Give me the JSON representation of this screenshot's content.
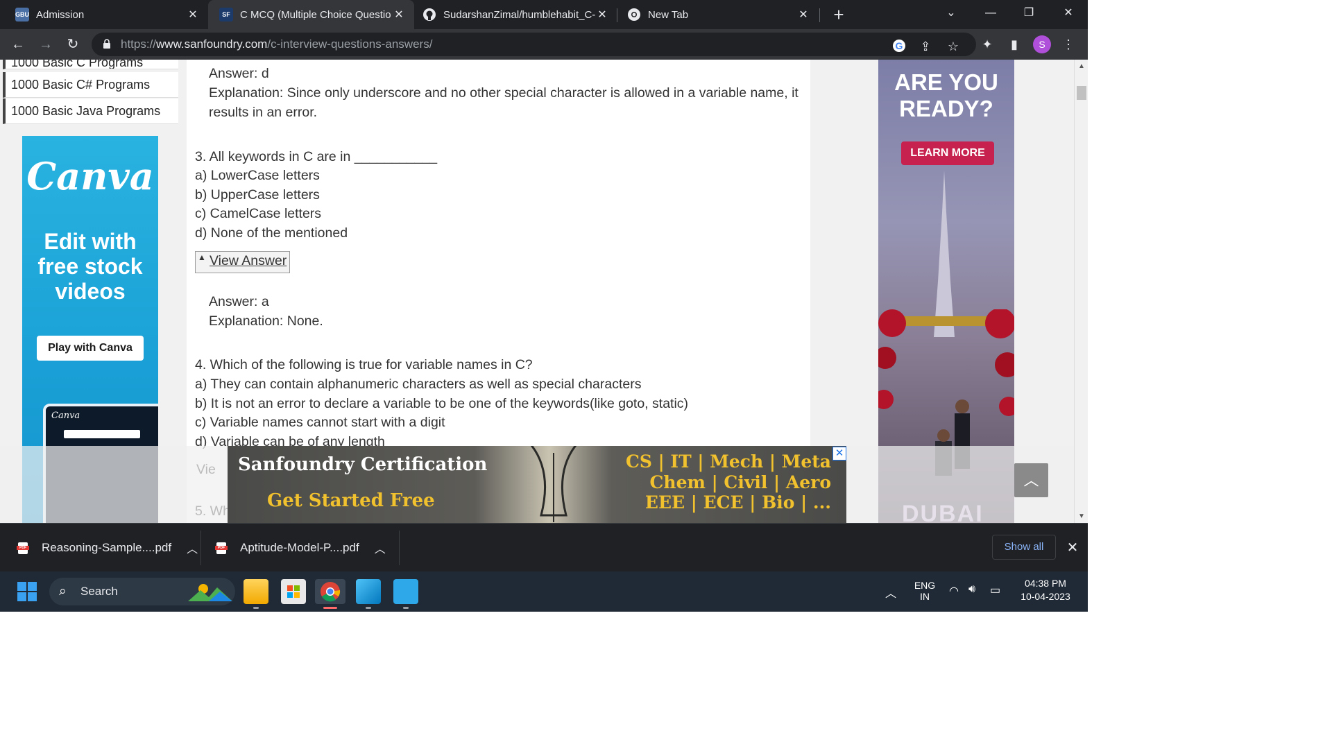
{
  "browser": {
    "tabs": [
      {
        "label": "Admission",
        "favicon": "gbu-logo-icon"
      },
      {
        "label": "C MCQ (Multiple Choice Questio",
        "favicon": "sanfoundry-logo-icon",
        "active": true
      },
      {
        "label": "SudarshanZimal/humblehabit_C-",
        "favicon": "github-icon"
      },
      {
        "label": "New Tab",
        "favicon": "chrome-icon"
      }
    ],
    "url_prefix": "https://",
    "url_domain": "www.sanfoundry.com",
    "url_path": "/c-interview-questions-answers/",
    "profile_initial": "S"
  },
  "sidebar": {
    "links": [
      "1000 Basic C Programs",
      "1000 Basic C# Programs",
      "1000 Basic Java Programs"
    ]
  },
  "canva_ad": {
    "logo": "Canva",
    "text": "Edit with free stock videos",
    "button": "Play with Canva",
    "mock_logo": "Canva"
  },
  "content": {
    "answer2": "Answer: d",
    "explanation2_line1": "Explanation: Since only underscore and no other special character is allowed in a variable name, it",
    "explanation2_line2": "results in an error.",
    "q3": {
      "question": "3. All keywords in C are in ___________",
      "options": [
        "a) LowerCase letters",
        "b) UpperCase letters",
        "c) CamelCase letters",
        "d) None of the mentioned"
      ]
    },
    "view_answer": "View Answer",
    "answer3": "Answer: a",
    "explanation3": "Explanation: None.",
    "q4": {
      "question": "4. Which of the following is true for variable names in C?",
      "options": [
        "a) They can contain alphanumeric characters as well as special characters",
        "b) It is not an error to declare a variable to be one of the keywords(like goto, static)",
        "c) Variable names cannot start with a digit",
        "d) Variable can be of any length"
      ]
    },
    "ghost_view": "Vie",
    "ghost_q5": "5. Wh"
  },
  "right_ad": {
    "heading": "ARE YOU READY?",
    "button": "LEARN MORE",
    "footer_text": "DUBAI"
  },
  "cert_banner": {
    "title": "Sanfoundry Certification",
    "cta": "Get Started Free",
    "line1": "CS | IT | Mech | Meta",
    "line2": "Chem | Civil | Aero",
    "line3": "EEE | ECE | Bio | ..."
  },
  "downloads": {
    "files": [
      "Reasoning-Sample....pdf",
      "Aptitude-Model-P....pdf"
    ],
    "show_all": "Show all"
  },
  "taskbar": {
    "search": "Search",
    "lang_line1": "ENG",
    "lang_line2": "IN",
    "time": "04:38 PM",
    "date": "10-04-2023"
  }
}
